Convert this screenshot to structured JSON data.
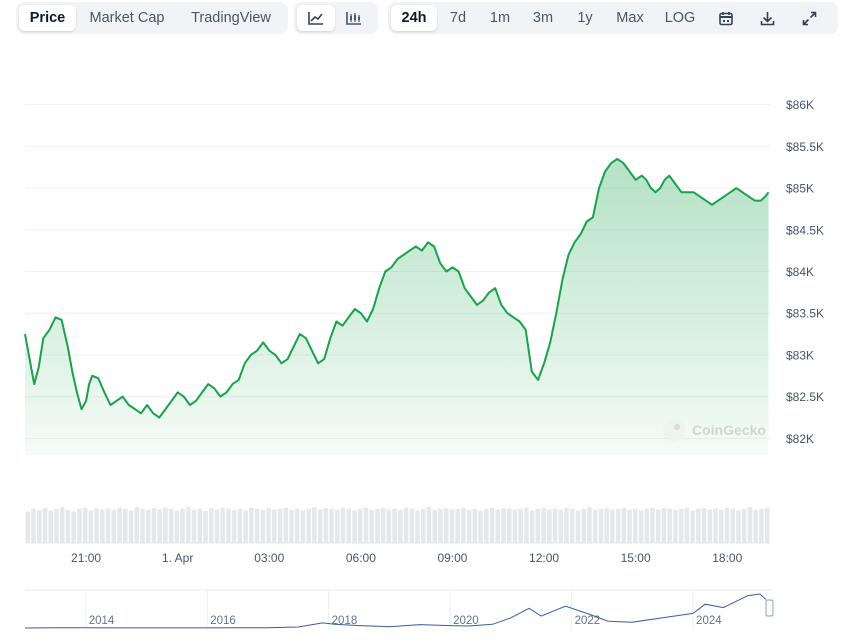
{
  "toolbar": {
    "metric_tabs": [
      {
        "label": "Price",
        "active": true
      },
      {
        "label": "Market Cap",
        "active": false
      },
      {
        "label": "TradingView",
        "active": false
      }
    ],
    "chart_type_icons": [
      "line-chart-icon",
      "candlestick-chart-icon"
    ],
    "ranges": [
      {
        "label": "24h",
        "active": true
      },
      {
        "label": "7d",
        "active": false
      },
      {
        "label": "1m",
        "active": false
      },
      {
        "label": "3m",
        "active": false
      },
      {
        "label": "1y",
        "active": false
      },
      {
        "label": "Max",
        "active": false
      },
      {
        "label": "LOG",
        "active": false
      }
    ],
    "tool_icons": [
      "calendar-icon",
      "download-icon",
      "fullscreen-icon"
    ]
  },
  "watermark": "CoinGecko",
  "colors": {
    "line": "#16a34a",
    "fill": "#16a34a",
    "grid": "#eef0f3",
    "volume": "#e5e7eb",
    "navigator": "#3b5ba5"
  },
  "chart_data": [
    {
      "type": "area",
      "title": "",
      "xlabel": "",
      "ylabel": "",
      "ylim": [
        81800,
        86200
      ],
      "yticks": [
        82000,
        82500,
        83000,
        83500,
        84000,
        84500,
        85000,
        85500,
        86000
      ],
      "ytick_labels": [
        "$82K",
        "$82.5K",
        "$83K",
        "$83.5K",
        "$84K",
        "$84.5K",
        "$85K",
        "$85.5K",
        "$86K"
      ],
      "xlim": [
        19.0,
        43.4
      ],
      "xticks": [
        21,
        24,
        27,
        30,
        33,
        36,
        39,
        42
      ],
      "xtick_labels": [
        "21:00",
        "1. Apr",
        "03:00",
        "06:00",
        "09:00",
        "12:00",
        "15:00",
        "18:00"
      ],
      "x": [
        19.0,
        19.15,
        19.3,
        19.45,
        19.6,
        19.8,
        20.0,
        20.2,
        20.4,
        20.55,
        20.7,
        20.85,
        21.0,
        21.1,
        21.2,
        21.4,
        21.6,
        21.8,
        22.0,
        22.2,
        22.4,
        22.6,
        22.8,
        23.0,
        23.2,
        23.4,
        23.6,
        23.8,
        24.0,
        24.2,
        24.4,
        24.6,
        24.8,
        25.0,
        25.2,
        25.4,
        25.6,
        25.8,
        26.0,
        26.2,
        26.4,
        26.6,
        26.8,
        27.0,
        27.2,
        27.4,
        27.6,
        27.8,
        28.0,
        28.2,
        28.4,
        28.6,
        28.8,
        29.0,
        29.2,
        29.4,
        29.6,
        29.8,
        30.0,
        30.2,
        30.4,
        30.6,
        30.8,
        31.0,
        31.2,
        31.4,
        31.6,
        31.8,
        32.0,
        32.2,
        32.4,
        32.6,
        32.8,
        33.0,
        33.2,
        33.4,
        33.6,
        33.8,
        34.0,
        34.2,
        34.4,
        34.6,
        34.8,
        35.0,
        35.2,
        35.4,
        35.6,
        35.8,
        36.0,
        36.2,
        36.4,
        36.6,
        36.8,
        37.0,
        37.2,
        37.4,
        37.6,
        37.8,
        38.0,
        38.2,
        38.4,
        38.6,
        38.8,
        39.0,
        39.2,
        39.35,
        39.5,
        39.65,
        39.8,
        39.95,
        40.1,
        40.3,
        40.5,
        40.7,
        40.9,
        41.1,
        41.3,
        41.5,
        41.7,
        41.9,
        42.1,
        42.3,
        42.5,
        42.7,
        42.9,
        43.1,
        43.25,
        43.35
      ],
      "series": [
        {
          "values": [
            83250,
            82950,
            82650,
            82850,
            83200,
            83300,
            83450,
            83420,
            83100,
            82800,
            82550,
            82350,
            82450,
            82650,
            82750,
            82720,
            82550,
            82400,
            82450,
            82500,
            82400,
            82350,
            82300,
            82400,
            82300,
            82250,
            82350,
            82450,
            82550,
            82500,
            82400,
            82450,
            82550,
            82650,
            82600,
            82500,
            82550,
            82650,
            82700,
            82900,
            83000,
            83050,
            83150,
            83050,
            83000,
            82900,
            82950,
            83100,
            83250,
            83200,
            83050,
            82900,
            82950,
            83200,
            83400,
            83350,
            83450,
            83550,
            83500,
            83400,
            83550,
            83800,
            84000,
            84050,
            84150,
            84200,
            84250,
            84300,
            84250,
            84350,
            84300,
            84100,
            84000,
            84050,
            84000,
            83800,
            83700,
            83600,
            83650,
            83750,
            83800,
            83600,
            83500,
            83450,
            83400,
            83300,
            82800,
            82700,
            82900,
            83150,
            83500,
            83900,
            84200,
            84350,
            84450,
            84600,
            84650,
            85000,
            85200,
            85300,
            85350,
            85300,
            85200,
            85100,
            85150,
            85100,
            85000,
            84950,
            85000,
            85100,
            85150,
            85050,
            84950,
            84950,
            84950,
            84900,
            84850,
            84800,
            84850,
            84900,
            84950,
            85000,
            84950,
            84900,
            84850,
            84850,
            84900,
            84950,
            84960,
            84960
          ]
        }
      ],
      "volume": [
        0.55,
        0.6,
        0.58,
        0.62,
        0.57,
        0.6,
        0.63,
        0.58,
        0.55,
        0.6,
        0.62,
        0.57,
        0.61,
        0.59,
        0.6,
        0.58,
        0.62,
        0.6,
        0.57,
        0.63,
        0.6,
        0.58,
        0.61,
        0.59,
        0.62,
        0.6,
        0.57,
        0.6,
        0.63,
        0.58,
        0.6,
        0.56,
        0.61,
        0.59,
        0.62,
        0.6,
        0.58,
        0.6,
        0.57,
        0.62,
        0.6,
        0.58,
        0.61,
        0.59,
        0.6,
        0.62,
        0.58,
        0.6,
        0.57,
        0.6,
        0.63,
        0.59,
        0.61,
        0.6,
        0.58,
        0.62,
        0.6,
        0.57,
        0.6,
        0.62,
        0.58,
        0.6,
        0.61,
        0.59,
        0.6,
        0.58,
        0.62,
        0.6,
        0.57,
        0.6,
        0.63,
        0.58,
        0.6,
        0.61,
        0.59,
        0.6,
        0.62,
        0.58,
        0.6,
        0.57,
        0.6,
        0.62,
        0.59,
        0.61,
        0.6,
        0.58,
        0.6,
        0.62,
        0.57,
        0.6,
        0.61,
        0.59,
        0.6,
        0.58,
        0.62,
        0.6,
        0.57,
        0.6,
        0.63,
        0.58,
        0.6,
        0.61,
        0.59,
        0.6,
        0.62,
        0.58,
        0.6,
        0.57,
        0.6,
        0.62,
        0.59,
        0.61,
        0.6,
        0.58,
        0.6,
        0.62,
        0.57,
        0.6,
        0.61,
        0.59,
        0.6,
        0.58,
        0.62,
        0.6,
        0.57,
        0.6,
        0.63,
        0.58,
        0.6,
        0.61
      ]
    },
    {
      "type": "line",
      "title": "",
      "xlabel": "",
      "ylabel": "",
      "xlim": [
        2013.0,
        2025.3
      ],
      "xticks": [
        2014,
        2016,
        2018,
        2020,
        2022,
        2024
      ],
      "xtick_labels": [
        "2014",
        "2016",
        "2018",
        "2020",
        "2022",
        "2024"
      ],
      "x": [
        2013.0,
        2013.5,
        2014.0,
        2014.5,
        2015.0,
        2015.5,
        2016.0,
        2016.5,
        2017.0,
        2017.5,
        2017.9,
        2018.1,
        2018.5,
        2019.0,
        2019.5,
        2020.0,
        2020.3,
        2020.7,
        2021.0,
        2021.3,
        2021.5,
        2021.9,
        2022.3,
        2022.6,
        2023.0,
        2023.5,
        2024.0,
        2024.2,
        2024.5,
        2024.9,
        2025.1,
        2025.2
      ],
      "values": [
        100,
        500,
        600,
        400,
        300,
        250,
        400,
        650,
        1000,
        3000,
        15000,
        11000,
        7000,
        3700,
        10000,
        7200,
        6000,
        11000,
        30000,
        58000,
        35000,
        64000,
        40000,
        20000,
        17000,
        30000,
        43000,
        70000,
        60000,
        95000,
        100000,
        84000
      ]
    }
  ]
}
